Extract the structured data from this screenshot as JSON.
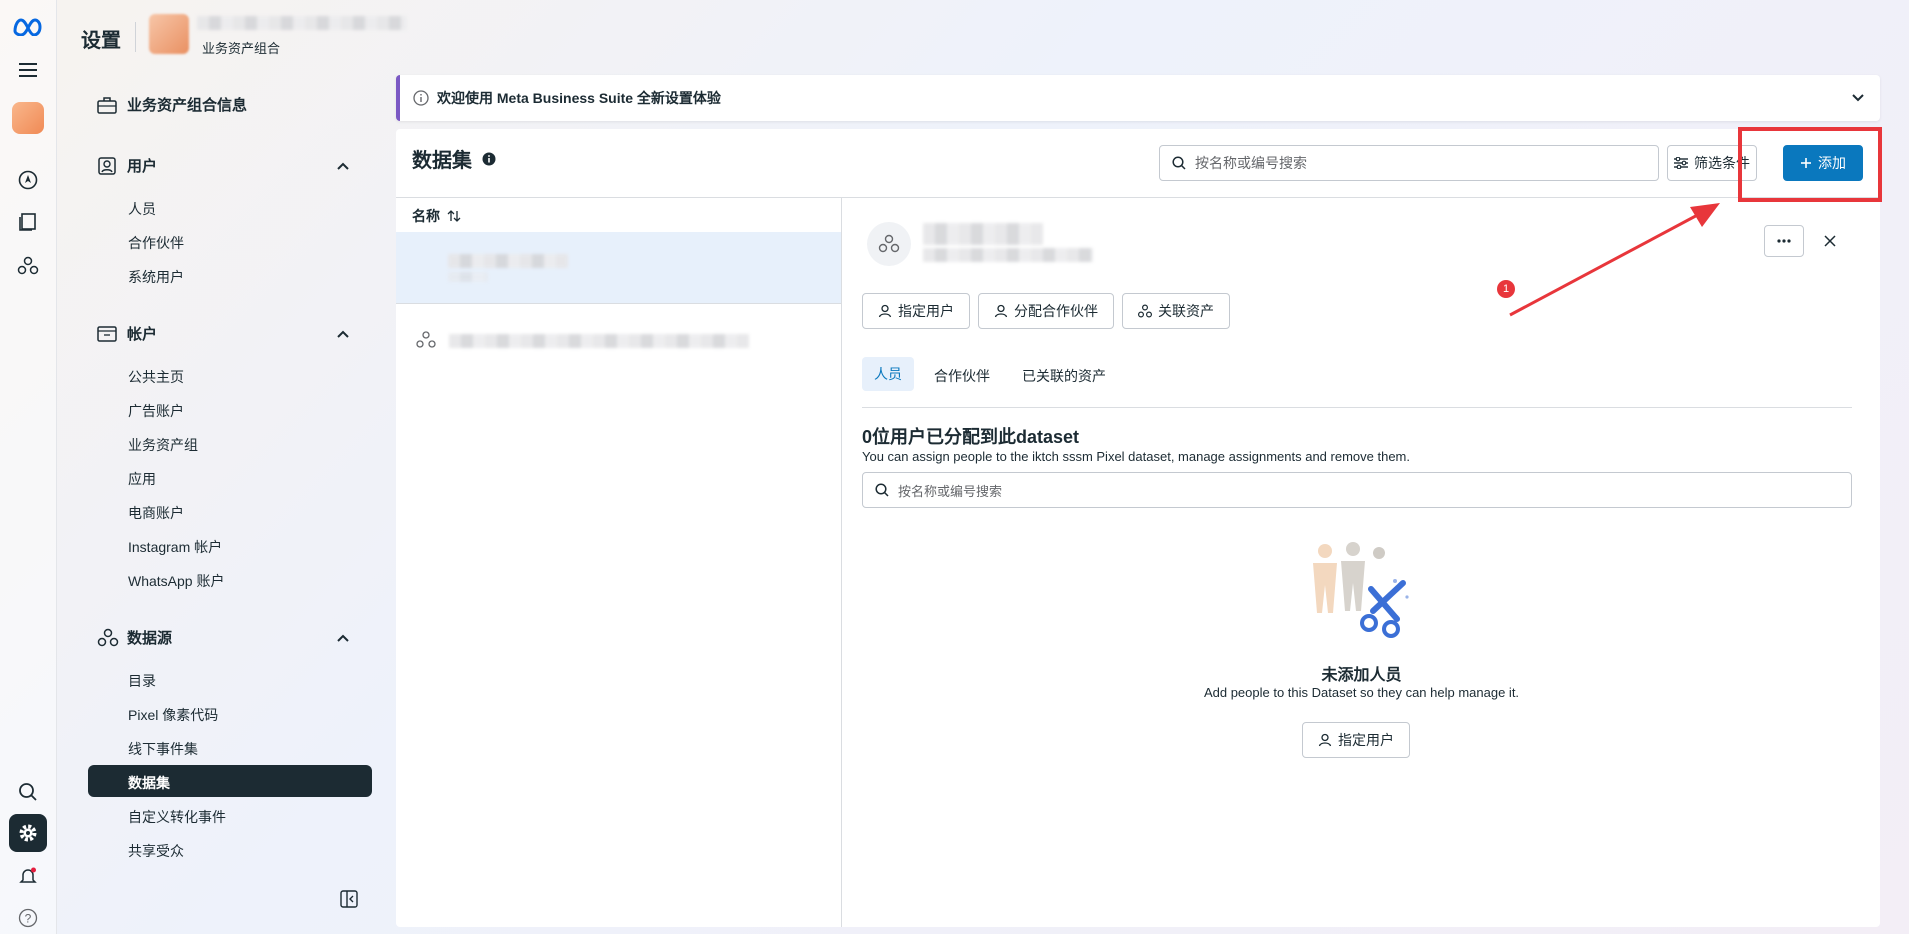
{
  "app": {
    "title": "设置",
    "portfolio_label": "业务资产组合"
  },
  "rail": {
    "icons": [
      "meta-logo",
      "menu-icon",
      "portfolio-avatar",
      "compass-icon",
      "pages-icon",
      "data-sources-icon",
      "search-icon",
      "gear-icon",
      "bell-icon",
      "help-icon"
    ]
  },
  "sidebar": {
    "top_item": "业务资产组合信息",
    "sections": [
      {
        "label": "用户",
        "items": [
          "人员",
          "合作伙伴",
          "系统用户"
        ]
      },
      {
        "label": "帐户",
        "items": [
          "公共主页",
          "广告账户",
          "业务资产组",
          "应用",
          "电商账户",
          "Instagram 帐户",
          "WhatsApp 账户"
        ]
      },
      {
        "label": "数据源",
        "items": [
          "目录",
          "Pixel 像素代码",
          "线下事件集",
          "数据集",
          "自定义转化事件",
          "共享受众"
        ]
      }
    ],
    "active_item": "数据集"
  },
  "banner": {
    "text": "欢迎使用 Meta Business Suite 全新设置体验"
  },
  "page": {
    "title": "数据集",
    "search_placeholder": "按名称或编号搜索",
    "filter_label": "筛选条件",
    "add_label": "添加"
  },
  "list": {
    "column_header": "名称",
    "sort_icon": "sort-icon"
  },
  "detail": {
    "actions": [
      "指定用户",
      "分配合作伙伴",
      "关联资产"
    ],
    "tabs": [
      "人员",
      "合作伙伴",
      "已关联的资产"
    ],
    "active_tab": "人员",
    "heading": "0位用户已分配到此dataset",
    "subtext": "You can assign people to the iktch sssm Pixel dataset, manage assignments and remove them.",
    "search_placeholder": "按名称或编号搜索",
    "empty_title": "未添加人员",
    "empty_text": "Add people to this Dataset so they can help manage it.",
    "empty_button": "指定用户"
  },
  "annotation": {
    "badge": "1",
    "color": "#e8363b"
  },
  "colors": {
    "primary": "#0a78be",
    "dark": "#1c2b33",
    "accent_border": "#7b59c4",
    "selected_row": "#e7f0fb"
  }
}
